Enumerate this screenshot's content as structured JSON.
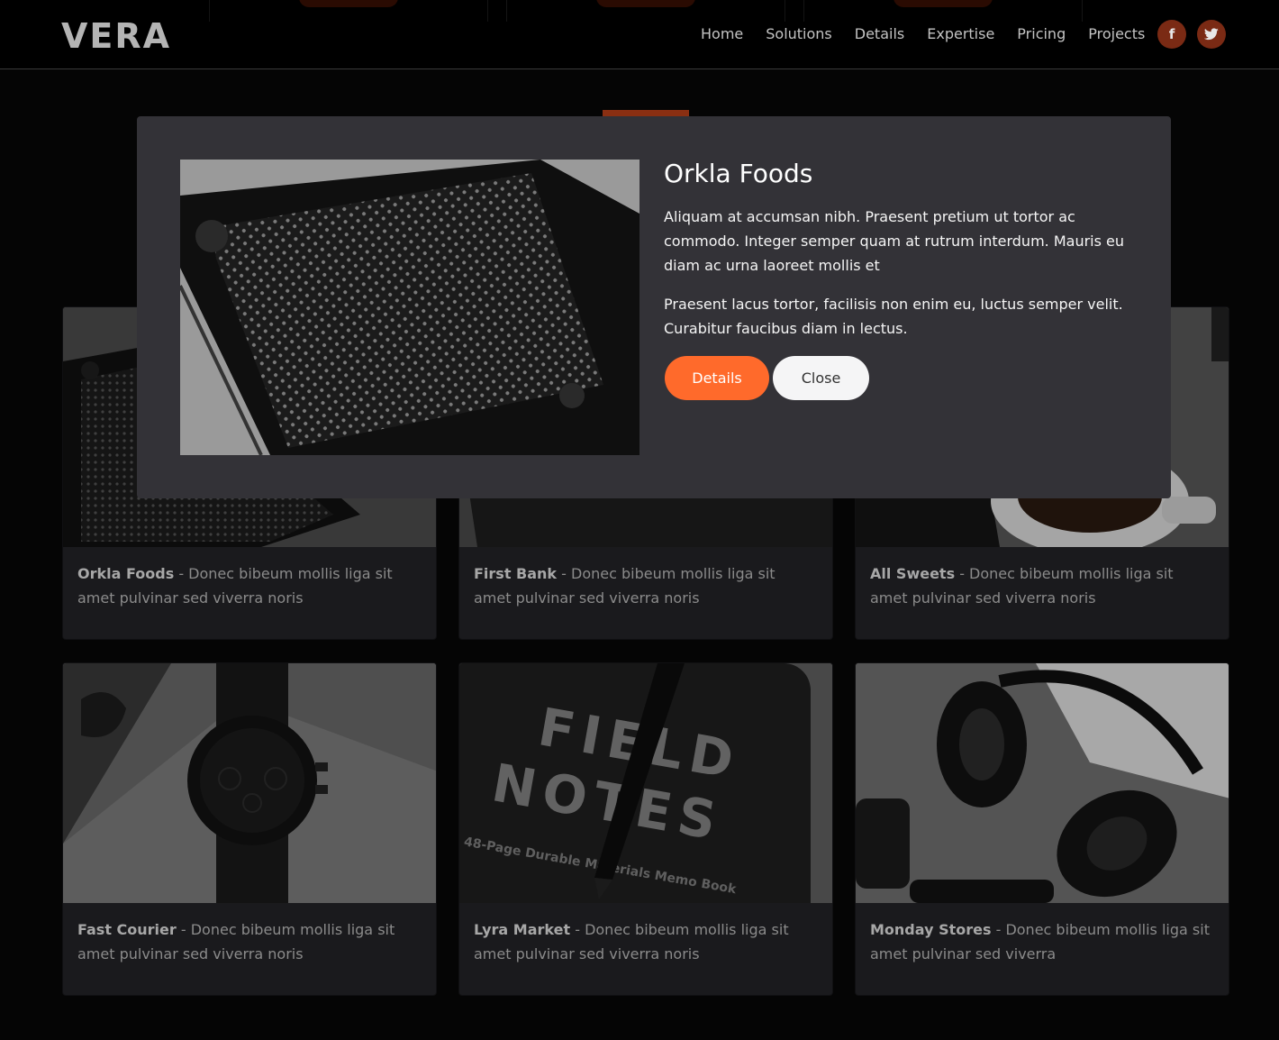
{
  "header": {
    "logo": "VERA",
    "nav": [
      "Home",
      "Solutions",
      "Details",
      "Expertise",
      "Pricing",
      "Projects"
    ],
    "social": [
      {
        "icon": "facebook-icon",
        "glyph": "f"
      },
      {
        "icon": "twitter-icon",
        "glyph": "🐦"
      }
    ]
  },
  "colors": {
    "accent": "#ff6a2b",
    "modal_bg": "#333237",
    "card_bg": "#1a1a1d",
    "page_bg": "#050505"
  },
  "cards": [
    {
      "title": "Orkla Foods",
      "desc": " - Donec bibeum mollis liga sit amet pulvinar sed viverra noris"
    },
    {
      "title": "First Bank",
      "desc": " - Donec bibeum mollis liga sit amet pulvinar sed viverra noris"
    },
    {
      "title": "All Sweets",
      "desc": " - Donec bibeum mollis liga sit amet pulvinar sed viverra noris"
    },
    {
      "title": "Fast Courier",
      "desc": " - Donec bibeum mollis liga sit amet pulvinar sed viverra noris"
    },
    {
      "title": "Lyra Market",
      "desc": " - Donec bibeum mollis liga sit amet pulvinar sed viverra noris"
    },
    {
      "title": "Monday Stores",
      "desc": " - Donec bibeum mollis liga sit amet pulvinar sed viverra"
    }
  ],
  "modal": {
    "title": "Orkla Foods",
    "paragraph1": "Aliquam at accumsan nibh. Praesent pretium ut tortor ac commodo. Integer semper quam at rutrum interdum. Mauris eu diam ac urna laoreet mollis et",
    "paragraph2": "Praesent lacus tortor, facilisis non enim eu, luctus semper velit. Curabitur faucibus diam in lectus.",
    "details_label": "Details",
    "close_label": "Close"
  },
  "images": {
    "notebook_text_1": "FIELD",
    "notebook_text_2": "NOTES",
    "notebook_text_3": "48-Page Durable Materials Memo Book"
  }
}
